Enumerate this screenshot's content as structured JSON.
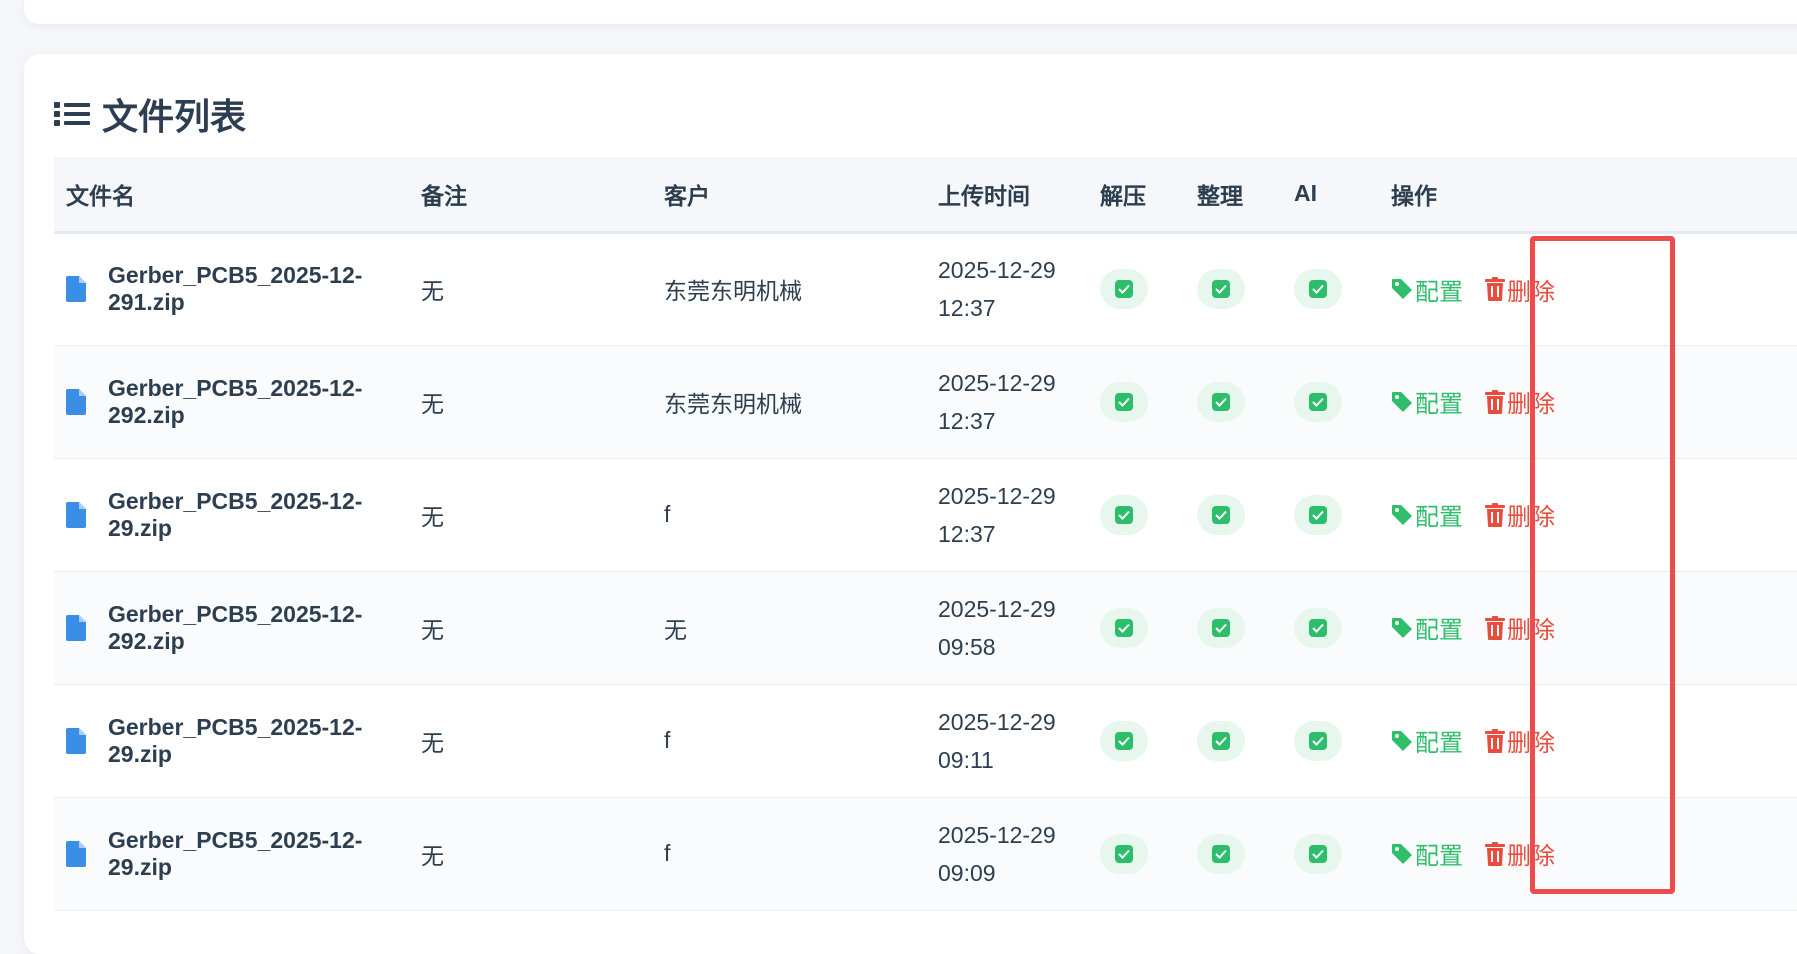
{
  "section": {
    "title": "文件列表",
    "icon": "list-icon"
  },
  "columns": {
    "filename": "文件名",
    "remark": "备注",
    "customer": "客户",
    "upload_time": "上传时间",
    "unzip": "解压",
    "organize": "整理",
    "ai": "AI",
    "actions": "操作"
  },
  "actions": {
    "config": "配置",
    "delete": "删除"
  },
  "rows": [
    {
      "filename": "Gerber_PCB5_2025-12-291.zip",
      "remark": "无",
      "customer": "东莞东明机械",
      "date": "2025-12-29",
      "time": "12:37"
    },
    {
      "filename": "Gerber_PCB5_2025-12-292.zip",
      "remark": "无",
      "customer": "东莞东明机械",
      "date": "2025-12-29",
      "time": "12:37"
    },
    {
      "filename": "Gerber_PCB5_2025-12-29.zip",
      "remark": "无",
      "customer": "f",
      "date": "2025-12-29",
      "time": "12:37"
    },
    {
      "filename": "Gerber_PCB5_2025-12-292.zip",
      "remark": "无",
      "customer": "无",
      "date": "2025-12-29",
      "time": "09:58"
    },
    {
      "filename": "Gerber_PCB5_2025-12-29.zip",
      "remark": "无",
      "customer": "f",
      "date": "2025-12-29",
      "time": "09:11"
    },
    {
      "filename": "Gerber_PCB5_2025-12-29.zip",
      "remark": "无",
      "customer": "f",
      "date": "2025-12-29",
      "time": "09:09"
    }
  ],
  "colors": {
    "accent_green": "#2fbf6b",
    "danger_red": "#e74c3c",
    "file_icon_blue": "#3a8ee6",
    "highlight": "#ee4c4c"
  }
}
